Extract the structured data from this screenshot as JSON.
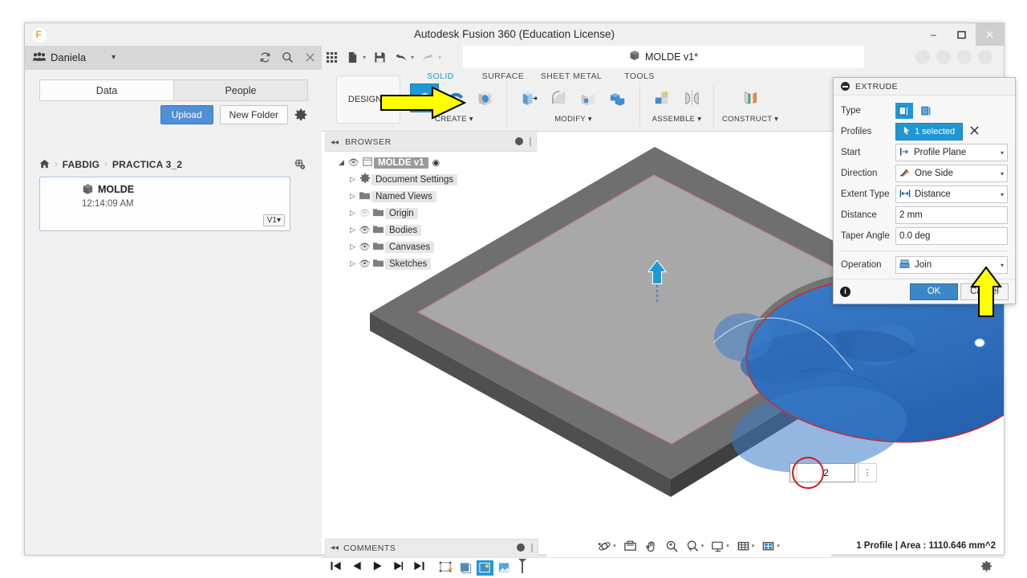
{
  "window": {
    "title": "Autodesk Fusion 360 (Education License)",
    "logo_icon": "fusion-logo-icon",
    "minimize_label": "–",
    "maximize_label": "❐",
    "close_label": "✕"
  },
  "data_panel": {
    "user_icon": "people-icon",
    "user_name": "Daniela",
    "caret": "▾",
    "refresh_icon": "refresh-icon",
    "search_icon": "search-icon",
    "close_icon": "close-icon",
    "tabs": [
      {
        "label": "Data",
        "active": true
      },
      {
        "label": "People",
        "active": false
      }
    ],
    "upload_label": "Upload",
    "new_folder_label": "New Folder",
    "settings_icon": "gear-icon",
    "breadcrumb": {
      "home_icon": "home-icon",
      "separator": "›",
      "items": [
        "FABDIG",
        "PRACTICA 3_2"
      ],
      "globe_icon": "globe-icon"
    },
    "file_card": {
      "cube_icon": "cube-icon",
      "name": "MOLDE",
      "timestamp": "12:14:09 AM",
      "version_label": "V1",
      "version_caret": "▾"
    }
  },
  "app_bar": {
    "grid_icon": "grid-apps-icon",
    "new_icon": "new-file-icon",
    "save_icon": "save-icon",
    "undo_icon": "undo-icon",
    "redo_icon": "redo-icon",
    "caret": "▾",
    "doc_tab": {
      "cube_icon": "cube-icon",
      "label": "MOLDE v1*"
    }
  },
  "ribbon": {
    "design_label": "DESIGN",
    "design_caret": "▾",
    "workspace_tabs": [
      {
        "label": "SOLID",
        "active": true
      },
      {
        "label": "SURFACE",
        "active": false
      },
      {
        "label": "SHEET METAL",
        "active": false
      },
      {
        "label": "TOOLS",
        "active": false
      }
    ],
    "groups": [
      {
        "caption": "CREATE",
        "caret": "▾",
        "tools": [
          {
            "icon": "extrude-icon",
            "selected": true
          },
          {
            "icon": "revolve-icon",
            "selected": false
          },
          {
            "icon": "sweep-icon",
            "selected": false
          }
        ]
      },
      {
        "caption": "MODIFY",
        "caret": "▾",
        "tools": [
          {
            "icon": "press-pull-icon",
            "selected": false
          },
          {
            "icon": "fillet-icon",
            "selected": false
          },
          {
            "icon": "shell-icon",
            "selected": false
          },
          {
            "icon": "combine-icon",
            "selected": false
          }
        ]
      },
      {
        "caption": "ASSEMBLE",
        "caret": "▾",
        "tools": [
          {
            "icon": "new-component-icon",
            "selected": false
          },
          {
            "icon": "joint-icon",
            "selected": false
          }
        ]
      },
      {
        "caption": "CONSTRUCT",
        "caret": "▾",
        "tools": [
          {
            "icon": "offset-plane-icon",
            "selected": false
          }
        ]
      }
    ]
  },
  "browser": {
    "header": {
      "collapse_icon": "collapse-left-icon",
      "title": "BROWSER",
      "minimize_icon": "minimize-dot-icon"
    },
    "nodes": [
      {
        "label": "MOLDE v1",
        "icon": "document-icon",
        "expander": "◢",
        "eye": "visible",
        "root": true,
        "radio": "◉"
      },
      {
        "label": "Document Settings",
        "icon": "gear-icon",
        "expander": "▷",
        "eye": "none"
      },
      {
        "label": "Named Views",
        "icon": "folder-icon",
        "expander": "▷",
        "eye": "none"
      },
      {
        "label": "Origin",
        "icon": "folder-icon",
        "expander": "▷",
        "eye": "hidden"
      },
      {
        "label": "Bodies",
        "icon": "folder-icon",
        "expander": "▷",
        "eye": "visible"
      },
      {
        "label": "Canvases",
        "icon": "folder-icon",
        "expander": "▷",
        "eye": "visible"
      },
      {
        "label": "Sketches",
        "icon": "folder-icon",
        "expander": "▷",
        "eye": "visible"
      }
    ]
  },
  "viewport": {
    "manipulator_arrow_icon": "extrude-direction-arrow-icon",
    "dimension_input": {
      "value": "2",
      "menu_icon": "more-options-icon"
    },
    "highlight_circle": "red-annotation-circle"
  },
  "comments": {
    "collapse_icon": "collapse-left-icon",
    "title": "COMMENTS",
    "minimize_icon": "minimize-dot-icon"
  },
  "nav_bar": {
    "items": [
      {
        "icon": "orbit-icon",
        "caret": "▾"
      },
      {
        "icon": "look-at-icon",
        "caret": ""
      },
      {
        "icon": "pan-icon",
        "caret": ""
      },
      {
        "icon": "zoom-icon",
        "caret": ""
      },
      {
        "icon": "zoom-window-icon",
        "caret": "▾"
      },
      {
        "icon": "display-settings-icon",
        "caret": "▾"
      },
      {
        "icon": "grid-snap-icon",
        "caret": "▾"
      },
      {
        "icon": "viewports-icon",
        "caret": "▾"
      }
    ]
  },
  "status_bar": {
    "text": "1 Profile | Area : 1110.646 mm^2"
  },
  "timeline": {
    "controls": [
      {
        "icon": "skip-to-start-icon"
      },
      {
        "icon": "step-back-icon"
      },
      {
        "icon": "play-icon"
      },
      {
        "icon": "step-forward-icon"
      },
      {
        "icon": "skip-to-end-icon"
      }
    ],
    "features": [
      {
        "icon": "sketch-feature-icon",
        "selected": false
      },
      {
        "icon": "canvas-feature-icon",
        "selected": false
      },
      {
        "icon": "sketch2-feature-icon",
        "selected": true
      },
      {
        "icon": "canvas2-feature-icon",
        "selected": false
      }
    ],
    "settings_icon": "gear-icon"
  },
  "extrude_dialog": {
    "minimize_icon": "minimize-dot-icon",
    "title": "EXTRUDE",
    "rows": [
      {
        "label": "Type",
        "kind": "typebuttons",
        "options": [
          {
            "icon": "extrude-profile-icon",
            "selected": true
          },
          {
            "icon": "extrude-edge-icon",
            "selected": false
          }
        ]
      },
      {
        "label": "Profiles",
        "kind": "selection",
        "value": "1 selected",
        "cursor_icon": "cursor-icon",
        "clear_icon": "clear-x-icon"
      },
      {
        "label": "Start",
        "kind": "dropdown",
        "value": "Profile Plane",
        "icon": "profile-plane-icon",
        "caret": "▾"
      },
      {
        "label": "Direction",
        "kind": "dropdown",
        "value": "One Side",
        "icon": "one-side-icon",
        "caret": "▾"
      },
      {
        "label": "Extent Type",
        "kind": "dropdown",
        "value": "Distance",
        "icon": "distance-icon",
        "caret": "▾"
      },
      {
        "label": "Distance",
        "kind": "text",
        "value": "2 mm"
      },
      {
        "label": "Taper Angle",
        "kind": "text",
        "value": "0.0 deg"
      },
      {
        "label": "Operation",
        "kind": "dropdown",
        "value": "Join",
        "icon": "join-icon",
        "caret": "▾"
      }
    ],
    "info_icon": "info-icon",
    "ok_label": "OK",
    "cancel_label": "Cancel"
  },
  "annotations": {
    "arrow_create_tool": "yellow-arrow-right",
    "arrow_ok_button": "yellow-arrow-up",
    "color": "#ffff00",
    "stroke": "#000000"
  },
  "colors": {
    "accent_blue": "#1a9ad7",
    "ok_blue": "#3c87c8",
    "upload_blue": "#4f8fd4",
    "chrome_gray": "#f0f0f0",
    "model_blue": "#2e6fba",
    "plate_gray": "#8c8c8c",
    "profile_red": "#cc2b2b"
  }
}
